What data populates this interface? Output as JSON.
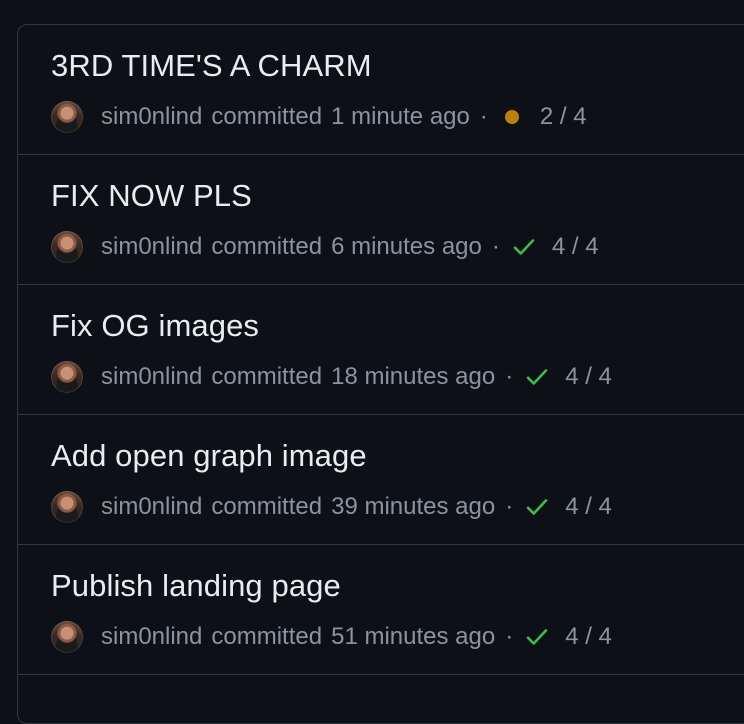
{
  "commits": [
    {
      "title": "3RD TIME'S A CHARM",
      "author": "sim0nlind",
      "verb": "committed",
      "time": "1 minute ago",
      "status": "pending",
      "checks": "2 / 4"
    },
    {
      "title": "FIX NOW PLS",
      "author": "sim0nlind",
      "verb": "committed",
      "time": "6 minutes ago",
      "status": "success",
      "checks": "4 / 4"
    },
    {
      "title": "Fix OG images",
      "author": "sim0nlind",
      "verb": "committed",
      "time": "18 minutes ago",
      "status": "success",
      "checks": "4 / 4"
    },
    {
      "title": "Add open graph image",
      "author": "sim0nlind",
      "verb": "committed",
      "time": "39 minutes ago",
      "status": "success",
      "checks": "4 / 4"
    },
    {
      "title": "Publish landing page",
      "author": "sim0nlind",
      "verb": "committed",
      "time": "51 minutes ago",
      "status": "success",
      "checks": "4 / 4"
    }
  ],
  "separator": "·",
  "colors": {
    "background": "#0d1117",
    "border": "#30363d",
    "title": "#e6edf3",
    "muted": "#8b949e",
    "pending": "#bb8009",
    "success": "#3fb950"
  },
  "icons": {
    "pending": "dot-fill-icon",
    "success": "check-icon"
  }
}
